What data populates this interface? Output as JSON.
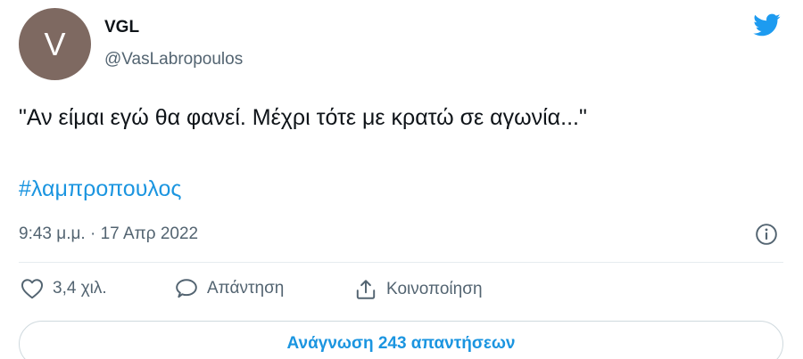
{
  "author": {
    "avatar_letter": "V",
    "avatar_color": "#7e6961",
    "display_name": "VGL",
    "handle": "@VasLabropoulos"
  },
  "tweet": {
    "text": "\"Αν είμαι εγώ θα φανεί. Μέχρι τότε με κρατώ σε αγωνία...\"",
    "hashtag": "#λαμπροπουλος",
    "timestamp": "9:43 μ.μ. · 17 Απρ 2022"
  },
  "actions": {
    "like_count": "3,4 χιλ.",
    "reply_label": "Απάντηση",
    "share_label": "Κοινοποίηση"
  },
  "read_replies_label": "Ανάγνωση 243 απαντήσεων",
  "icons": {
    "brand": "twitter-bird-icon",
    "info": "info-icon",
    "like": "heart-icon",
    "reply": "speech-bubble-icon",
    "share": "share-icon"
  },
  "colors": {
    "accent": "#1b95e0",
    "bird": "#1d9bf0",
    "secondary_text": "#536471"
  }
}
